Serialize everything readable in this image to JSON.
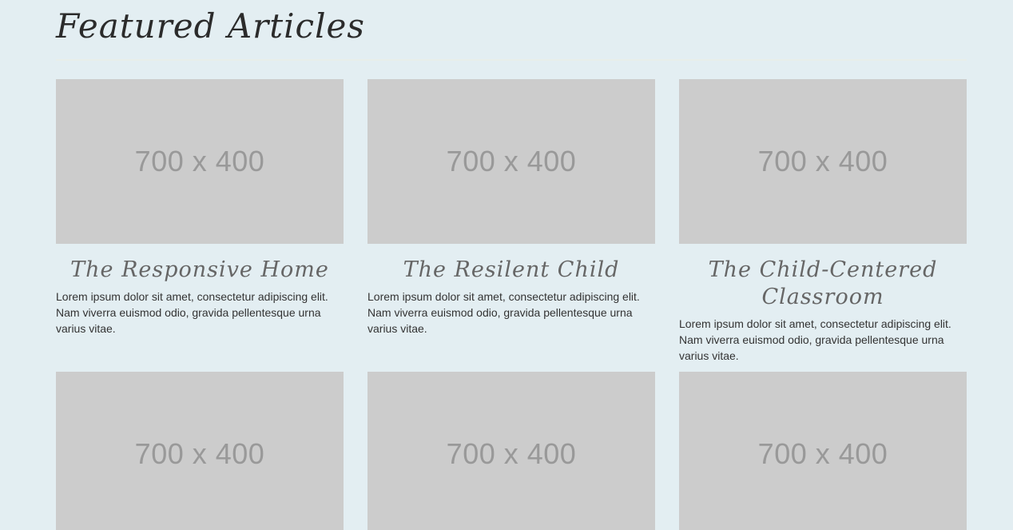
{
  "section": {
    "title": "Featured Articles"
  },
  "articles": [
    {
      "image_label": "700 x 400",
      "title": "The Responsive Home",
      "excerpt": "Lorem ipsum dolor sit amet, consectetur adipiscing elit. Nam viverra euismod odio, gravida pellentesque urna varius vitae."
    },
    {
      "image_label": "700 x 400",
      "title": "The Resilent Child",
      "excerpt": "Lorem ipsum dolor sit amet, consectetur adipiscing elit. Nam viverra euismod odio, gravida pellentesque urna varius vitae."
    },
    {
      "image_label": "700 x 400",
      "title": "The Child-Centered Classroom",
      "excerpt": "Lorem ipsum dolor sit amet, consectetur adipiscing elit. Nam viverra euismod odio, gravida pellentesque urna varius vitae."
    },
    {
      "image_label": "700 x 400"
    },
    {
      "image_label": "700 x 400"
    },
    {
      "image_label": "700 x 400"
    }
  ],
  "colors": {
    "page_background": "#e3eef2",
    "placeholder_background": "#cccccc",
    "placeholder_text": "#999999",
    "heading_text": "#2b2b2b",
    "card_title_text": "#666666",
    "body_text": "#333333"
  }
}
